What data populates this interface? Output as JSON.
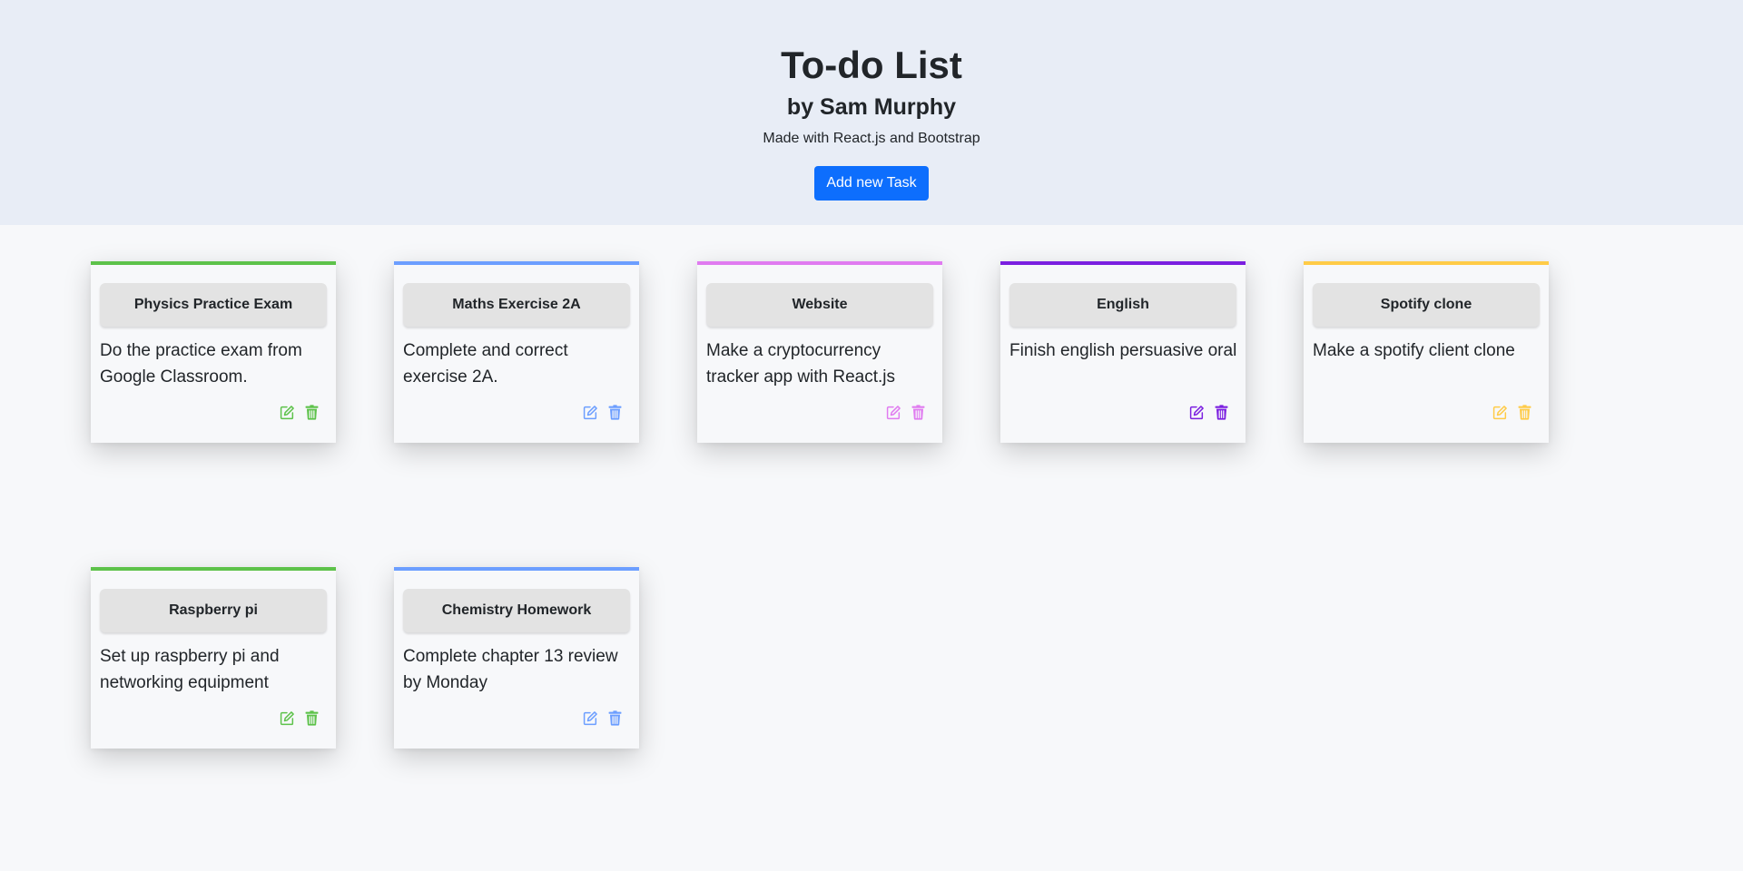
{
  "header": {
    "title": "To-do List",
    "author": "by Sam Murphy",
    "subtitle": "Made with React.js and Bootstrap",
    "add_button_label": "Add new Task"
  },
  "icons": {
    "edit": "edit-icon",
    "delete": "trash-icon"
  },
  "tasks": [
    {
      "title": "Physics Practice Exam",
      "description": "Do the practice exam from Google Classroom.",
      "color": "#5dc24a"
    },
    {
      "title": "Maths Exercise 2A",
      "description": "Complete and correct exercise 2A.",
      "color": "#6c9eff"
    },
    {
      "title": "Website",
      "description": "Make a cryptocurrency tracker app with React.js",
      "color": "#e07bf0"
    },
    {
      "title": "English",
      "description": "Finish english persuasive oral",
      "color": "#7b1fe0"
    },
    {
      "title": "Spotify clone",
      "description": "Make a spotify client clone",
      "color": "#ffcb47"
    },
    {
      "title": "Raspberry pi",
      "description": "Set up raspberry pi and networking equipment",
      "color": "#5dc24a"
    },
    {
      "title": "Chemistry Homework",
      "description": "Complete chapter 13 review by Monday",
      "color": "#6c9eff"
    }
  ]
}
